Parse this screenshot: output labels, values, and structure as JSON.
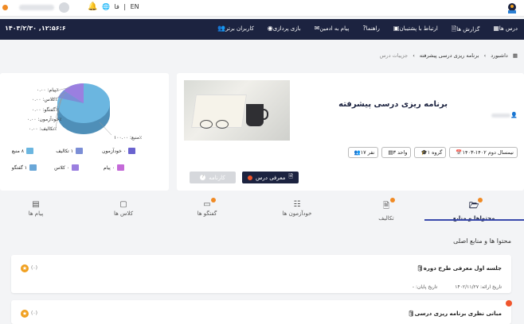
{
  "topbar": {
    "lang_current": "فا",
    "lang_sep": "|",
    "lang_other": "EN"
  },
  "nav": {
    "time": "۱۴۰۳/۲/۳۰ ,۱۲:۵۶:۶",
    "items": [
      {
        "label": "درس ها",
        "icon": "grid-icon"
      },
      {
        "label": "گزارش ها",
        "icon": "report-icon"
      },
      {
        "label": "ارتباط با پشتیبان",
        "icon": "support-icon"
      },
      {
        "label": "راهنما",
        "icon": "help-icon"
      },
      {
        "label": "پیام به ادمین",
        "icon": "message-icon"
      },
      {
        "label": "بازی پردازی",
        "icon": "game-icon"
      },
      {
        "label": "کاربران برتر",
        "icon": "users-icon"
      }
    ]
  },
  "breadcrumb": {
    "home": "داشبورد",
    "sep": "›",
    "course": "برنامه ریزی درسی پیشرفته",
    "current": "جزییات درس"
  },
  "course": {
    "title": "برنامه ریزی درسی پیشرفته",
    "chips": [
      {
        "label": "نیمسال دوم ۱۴۰۲-۱۴۰۳",
        "icon": "calendar-icon"
      },
      {
        "label": "گروه ۱",
        "icon": "cap-icon"
      },
      {
        "label": "واحد ۳",
        "icon": "unit-icon"
      },
      {
        "label": "۱۷ نفر",
        "icon": "people-icon"
      }
    ],
    "intro_button": "معرفی درس",
    "report_button": "کارنامه"
  },
  "pie": {
    "labels": {
      "payam": "پیام: ۰.۰۰٪",
      "kelas": "کلاس: ۰.۰۰٪",
      "goftogu": "گفتگو: ۰.۰۰٪",
      "khodazmoon": "خودآزمون: ۰.۰۰٪",
      "taklif": "تکالیف: ۰.۰۰٪",
      "manba": "منبع: ۱۰۰.۰۰٪"
    },
    "legend": [
      {
        "label": "۸ منبع",
        "color": "#6bb6e0"
      },
      {
        "label": "۱ تکالیف",
        "color": "#7b8ed6"
      },
      {
        "label": "۰ خودآزمون",
        "color": "#6a63cf"
      },
      {
        "label": "۱ گفتگو",
        "color": "#6aa7d8"
      },
      {
        "label": "۰ کلاس",
        "color": "#9b7fe0"
      },
      {
        "label": "۰ پیام",
        "color": "#c46ad8"
      }
    ]
  },
  "tabs": [
    {
      "label": "محتواها و منابع",
      "icon": "content-icon",
      "badge": true
    },
    {
      "label": "تکالیف",
      "icon": "assignment-icon",
      "badge": true
    },
    {
      "label": "خودآزمون ها",
      "icon": "quiz-icon",
      "badge": false
    },
    {
      "label": "گفتگو ها",
      "icon": "chat-icon",
      "badge": true
    },
    {
      "label": "کلاس ها",
      "icon": "class-icon",
      "badge": false
    },
    {
      "label": "پیام ها",
      "icon": "messages-icon",
      "badge": false
    }
  ],
  "section": {
    "title": "محتوا ها و منابع اصلی"
  },
  "sessions": [
    {
      "title": "جلسه اول معرفی طرح دوره",
      "date_label": "تاریخ ارائه: ۱۴۰۲/۱۱/۲۷",
      "end_label": "تاریخ پایان: -",
      "count": "(۰)"
    },
    {
      "title": "مبانی نظری برنامه ریزی درسی",
      "count": "(۰)"
    }
  ]
}
